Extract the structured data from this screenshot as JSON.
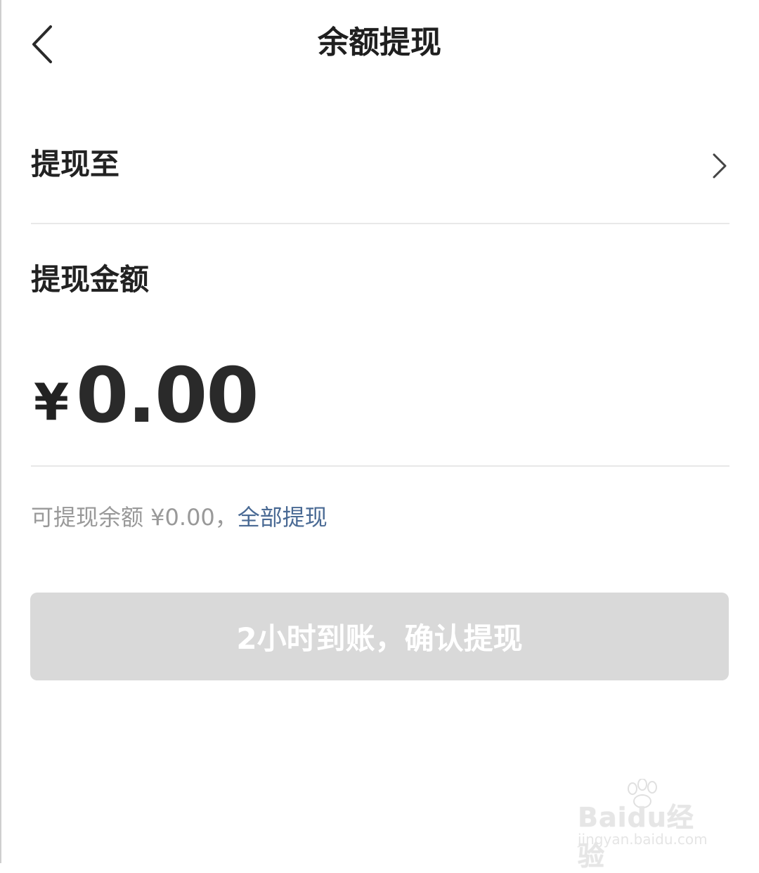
{
  "header": {
    "title": "余额提现",
    "back_icon": "chevron-left-icon"
  },
  "destination": {
    "label": "提现至",
    "account": "",
    "chevron_icon": "chevron-right-icon"
  },
  "amount": {
    "label": "提现金额",
    "currency": "¥",
    "value": "0.00"
  },
  "balance": {
    "text": "可提现余额 ¥0.00，",
    "withdraw_all": "全部提现"
  },
  "confirm": {
    "label": "2小时到账，确认提现"
  },
  "watermark": {
    "brand": "Baidu经验",
    "url": "jingyan.baidu.com"
  },
  "colors": {
    "link": "#4a6a94",
    "button_disabled": "#d9d9d9",
    "muted_text": "#999999"
  }
}
